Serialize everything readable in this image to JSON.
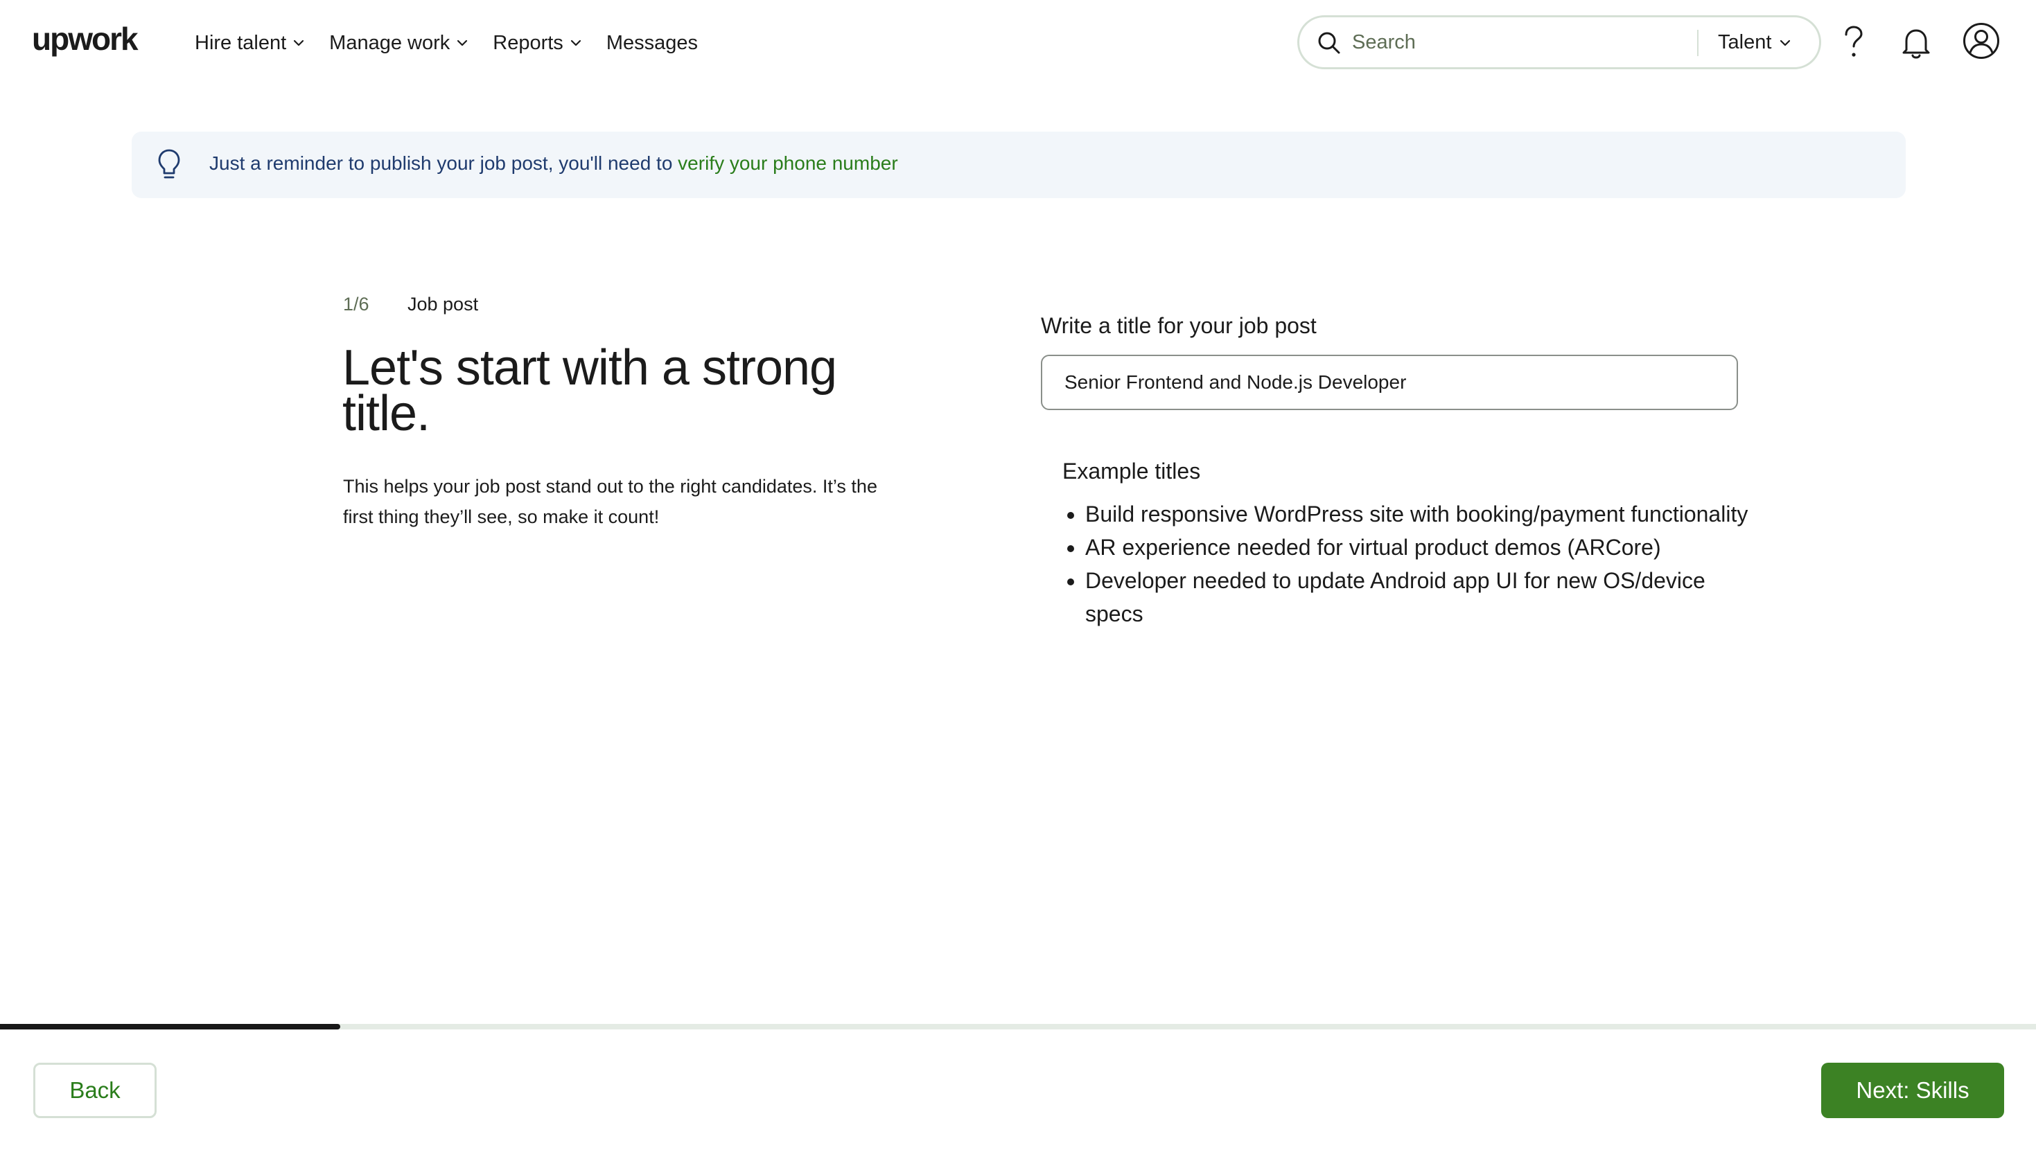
{
  "header": {
    "logo_text": "upwork",
    "nav": [
      {
        "label": "Hire talent",
        "has_dropdown": true
      },
      {
        "label": "Manage work",
        "has_dropdown": true
      },
      {
        "label": "Reports",
        "has_dropdown": true
      },
      {
        "label": "Messages",
        "has_dropdown": false
      }
    ],
    "search": {
      "placeholder": "Search",
      "scope": "Talent"
    },
    "icons": [
      "help-icon",
      "bell-icon",
      "user-avatar-icon"
    ]
  },
  "banner": {
    "icon": "lightbulb-icon",
    "text": "Just a reminder to publish your job post, you'll need to ",
    "link": "verify your phone number"
  },
  "intro": {
    "step_counter": "1/6",
    "step_name": "Job post",
    "headline": "Let's start with a strong title.",
    "subtext": "This helps your job post stand out to the right candidates. It’s the first thing they’ll see, so make it count!"
  },
  "form": {
    "title_label": "Write a title for your job post",
    "title_value": "Senior Frontend and Node.js Developer",
    "examples_heading": "Example titles",
    "examples": [
      "Build responsive WordPress site with booking/payment functionality",
      "AR experience needed for virtual product demos (ARCore)",
      "Developer needed to update Android app UI for new OS/device specs"
    ]
  },
  "progress": {
    "current_step": 1,
    "total_steps": 6,
    "fraction": 0.167
  },
  "footer": {
    "back_label": "Back",
    "next_label": "Next: Skills"
  },
  "colors": {
    "brand_green": "#3c8224",
    "link_green": "#2a7d1b",
    "banner_bg": "#f2f6fa",
    "banner_text": "#1f3b6e",
    "progress_fill": "#181818"
  }
}
